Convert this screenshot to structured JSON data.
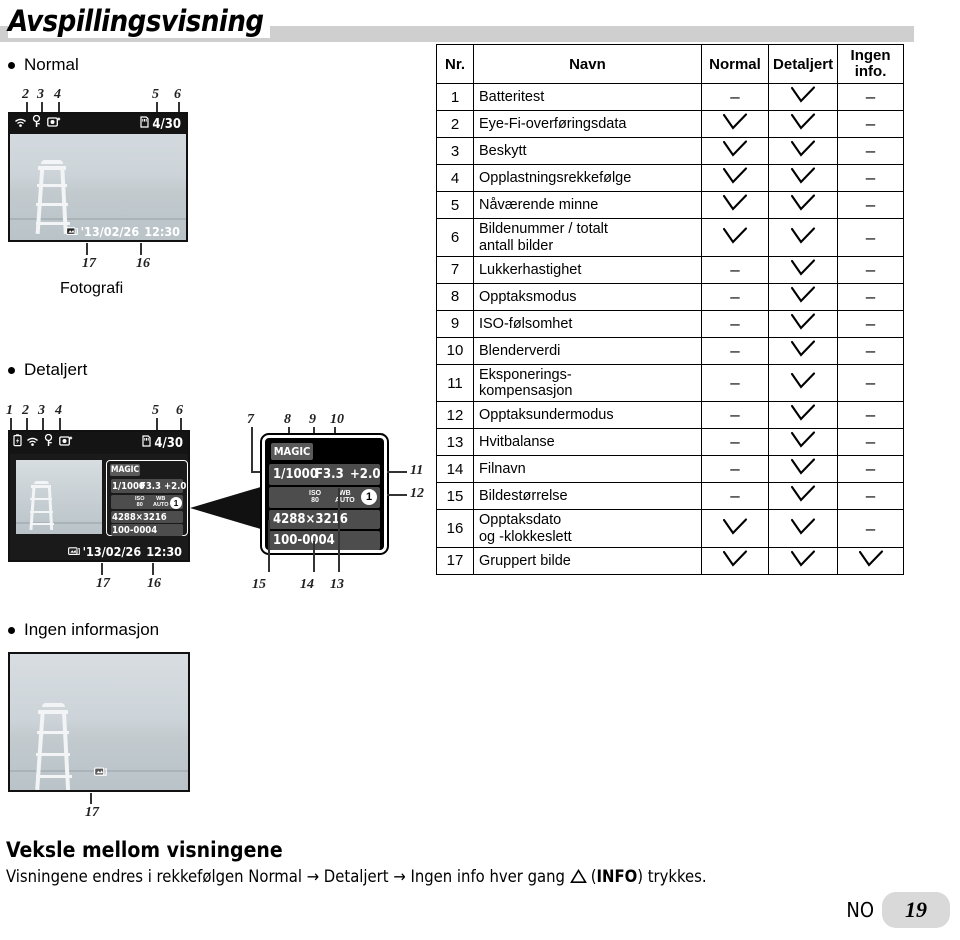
{
  "page": {
    "title": "Avspillingsvisning",
    "footer_lang": "NO",
    "footer_page": "19"
  },
  "sections": {
    "normal": {
      "label": "Normal",
      "caption": "Fotografi"
    },
    "detailed": {
      "label": "Detaljert"
    },
    "noinfo": {
      "label": "Ingen informasjon"
    }
  },
  "normal_screen": {
    "icons": [
      "eyefi-icon",
      "protect-key-icon",
      "upload-order-icon"
    ],
    "card_icon": "memory-card-icon",
    "frame_counter": "4/30",
    "group_icon": "grouped-image-icon",
    "date": "'13/02/26",
    "time": "12:30",
    "callouts": {
      "top": [
        "2",
        "3",
        "4",
        "5",
        "6"
      ],
      "bottom": [
        "17",
        "16"
      ]
    }
  },
  "detailed_screen": {
    "icons": [
      "battery-icon",
      "eyefi-icon",
      "protect-key-icon",
      "upload-order-icon"
    ],
    "card_icon": "memory-card-icon",
    "frame_counter": "4/30",
    "group_icon": "grouped-image-icon",
    "date": "'13/02/26",
    "time": "12:30",
    "callouts": {
      "top": [
        "1",
        "2",
        "3",
        "4",
        "5",
        "6"
      ],
      "bottom": [
        "17",
        "16"
      ]
    },
    "osd": {
      "magic": "MAGIC",
      "shutter": "1/1000",
      "aperture": "F3.3",
      "exposure_comp": "+2.0",
      "iso_label": "ISO",
      "iso_value": "80",
      "wb_label": "WB",
      "wb_value": "AUTO",
      "drive_badge": "1",
      "image_size": "4288×3216",
      "filename": "100-0004"
    }
  },
  "detail_panel": {
    "callouts_top": [
      "7",
      "8",
      "9",
      "10"
    ],
    "callouts_right": [
      "11",
      "12"
    ],
    "callouts_bottom": [
      "15",
      "14",
      "13"
    ]
  },
  "noinfo_screen": {
    "group_icon": "grouped-image-icon",
    "callouts": {
      "bottom": [
        "17"
      ]
    }
  },
  "table": {
    "headers": [
      "Nr.",
      "Navn",
      "Normal",
      "Detaljert",
      "Ingen info."
    ],
    "header_ingen_line1": "Ingen",
    "header_ingen_line2": "info.",
    "mark_check": "check",
    "mark_dash": "–",
    "rows": [
      {
        "no": "1",
        "name": "Batteritest",
        "normal": "–",
        "detaljert": "check",
        "ingen": "–"
      },
      {
        "no": "2",
        "name": "Eye-Fi-overføringsdata",
        "normal": "check",
        "detaljert": "check",
        "ingen": "–"
      },
      {
        "no": "3",
        "name": "Beskytt",
        "normal": "check",
        "detaljert": "check",
        "ingen": "–"
      },
      {
        "no": "4",
        "name": "Opplastningsrekkefølge",
        "normal": "check",
        "detaljert": "check",
        "ingen": "–"
      },
      {
        "no": "5",
        "name": "Nåværende minne",
        "normal": "check",
        "detaljert": "check",
        "ingen": "–"
      },
      {
        "no": "6",
        "name": "Bildenummer / totalt antall bilder",
        "normal": "check",
        "detaljert": "check",
        "ingen": "–"
      },
      {
        "no": "7",
        "name": "Lukkerhastighet",
        "normal": "–",
        "detaljert": "check",
        "ingen": "–"
      },
      {
        "no": "8",
        "name": "Opptaksmodus",
        "normal": "–",
        "detaljert": "check",
        "ingen": "–"
      },
      {
        "no": "9",
        "name": "ISO-følsomhet",
        "normal": "–",
        "detaljert": "check",
        "ingen": "–"
      },
      {
        "no": "10",
        "name": "Blenderverdi",
        "normal": "–",
        "detaljert": "check",
        "ingen": "–"
      },
      {
        "no": "11",
        "name": "Eksponerings- kompensasjon",
        "normal": "–",
        "detaljert": "check",
        "ingen": "–"
      },
      {
        "no": "12",
        "name": "Opptaksundermodus",
        "normal": "–",
        "detaljert": "check",
        "ingen": "–"
      },
      {
        "no": "13",
        "name": "Hvitbalanse",
        "normal": "–",
        "detaljert": "check",
        "ingen": "–"
      },
      {
        "no": "14",
        "name": "Filnavn",
        "normal": "–",
        "detaljert": "check",
        "ingen": "–"
      },
      {
        "no": "15",
        "name": "Bildestørrelse",
        "normal": "–",
        "detaljert": "check",
        "ingen": "–"
      },
      {
        "no": "16",
        "name": "Opptaksdato og -klokkeslett",
        "normal": "check",
        "detaljert": "check",
        "ingen": "–"
      },
      {
        "no": "17",
        "name": "Gruppert bilde",
        "normal": "check",
        "detaljert": "check",
        "ingen": "check"
      }
    ],
    "row_name_lines": {
      "6": [
        "Bildenummer / totalt",
        "antall bilder"
      ],
      "11": [
        "Eksponerings-",
        "kompensasjon"
      ],
      "16": [
        "Opptaksdato",
        "og -klokkeslett"
      ]
    }
  },
  "note": {
    "title": "Veksle mellom visningene",
    "body_pre": "Visningene endres i rekkefølgen Normal → Detaljert → Ingen info hver gang ",
    "body_key": "INFO",
    "body_post": ") trykkes.",
    "body_paren_open": "("
  }
}
